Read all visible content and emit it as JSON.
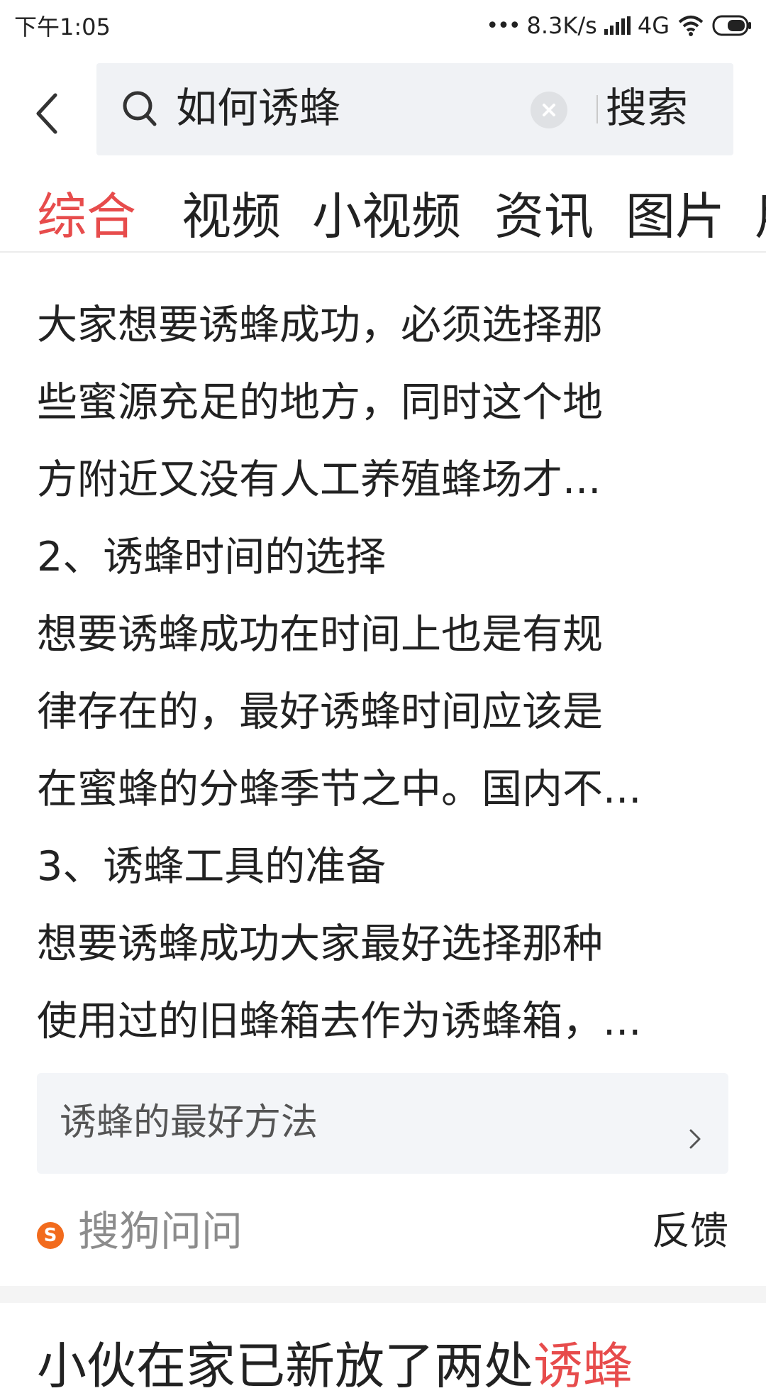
{
  "status_bar": {
    "time": "下午1:05",
    "network_speed": "8.3K/s",
    "network_type": "4G"
  },
  "search": {
    "query": "如何诱蜂",
    "button_label": "搜索"
  },
  "tabs": [
    {
      "label": "综合",
      "active": true
    },
    {
      "label": "视频",
      "active": false
    },
    {
      "label": "小视频",
      "active": false
    },
    {
      "label": "资讯",
      "active": false
    },
    {
      "label": "图片",
      "active": false
    },
    {
      "label": "用",
      "active": false
    }
  ],
  "content": {
    "lines": [
      "大家想要诱蜂成功，必须选择那",
      "些蜜源充足的地方，同时这个地",
      "方附近又没有人工养殖蜂场才...",
      "2、诱蜂时间的选择",
      "想要诱蜂成功在时间上也是有规",
      "律存在的，最好诱蜂时间应该是",
      "在蜜蜂的分蜂季节之中。国内不...",
      "3、诱蜂工具的准备",
      "想要诱蜂成功大家最好选择那种",
      "使用过的旧蜂箱去作为诱蜂箱，..."
    ]
  },
  "related": {
    "label": "诱蜂的最好方法"
  },
  "source": {
    "icon_letter": "S",
    "name": "搜狗问问",
    "feedback_label": "反馈"
  },
  "next_result": {
    "title_prefix": "小伙在家已新放了两处",
    "title_highlight": "诱蜂"
  },
  "colors": {
    "accent": "#e74c4c",
    "search_bg": "#f0f2f5",
    "card_bg": "#f3f5f8",
    "sogou": "#f26b1d"
  }
}
